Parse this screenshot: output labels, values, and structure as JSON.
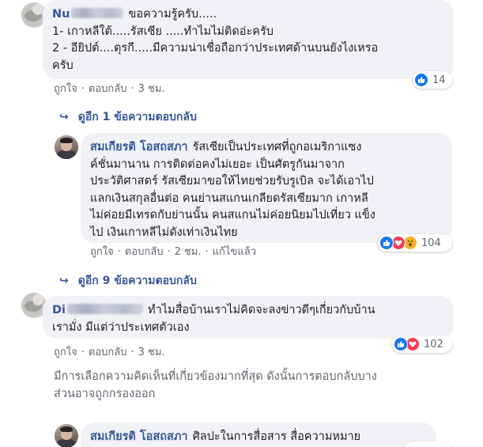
{
  "comments": [
    {
      "author": "Nu",
      "lines": [
        "ขอความรู้ครับ.....",
        "1- เกาหลีใต้.....รัสเซีย .....ทำไมไม่ติดอ่ะครับ",
        "2 - อียิปต์....ตุรกี.....มีความน่าเชื่อถือกว่าประเทศด้านบนยังไงเหรอ",
        "ครับ"
      ],
      "actions": {
        "like": "ถูกใจ",
        "reply": "ตอบกลับ",
        "time": "3 ชม."
      },
      "reaction_count": "14",
      "reactions": [
        "like"
      ]
    },
    {
      "view_replies": "ดูอีก 1 ข้อความตอบกลับ"
    },
    {
      "author": "สมเกียรติ โอสถสภา",
      "lines": [
        "รัสเซียเป็นประเทศที่ถูกอเมริกาแซง",
        "ค์ชั่นมานาน การติดต่อคงไม่เยอะ เป็นศัตรูกันมาจาก",
        "ประวัติศาสตร์ รัสเซียมาขอให้ไทยช่วยรับรูเบิล จะได้เอาไป",
        "แลกเงินสกุลอื่นต่อ คนย่านสแกนเกลียดรัสเซียมาก เกาหลี",
        "ไม่ค่อยมีเทรดกับย่านนั้น คนสแกนไม่ค่อยนิยมไปเที่ยว แข็ง",
        "ไป เงินเกาหลีไม่ดังเท่าเงินไทย"
      ],
      "actions": {
        "like": "ถูกใจ",
        "reply": "ตอบกลับ",
        "time": "2 ชม.",
        "edited": "แก้ไขแล้ว"
      },
      "reaction_count": "104",
      "reactions": [
        "like",
        "love",
        "wow"
      ]
    },
    {
      "view_replies": "ดูอีก 9 ข้อความตอบกลับ"
    },
    {
      "author": "Di",
      "lines": [
        "ทำไมสื่อบ้านเราไม่คิดจะลงข่าวดีๆเกี่ยวกับบ้าน",
        "เรามั่ง มีแต่ว่าประเทศตัวเอง"
      ],
      "actions": {
        "like": "ถูกใจ",
        "reply": "ตอบกลับ",
        "time": "3 ชม."
      },
      "reaction_count": "102",
      "reactions": [
        "like",
        "love"
      ]
    },
    {
      "notice_lines": [
        "มีการเลือกความคิดเห็นที่เกี่ยวข้องมากที่สุด ดังนั้นการตอบกลับบาง",
        "ส่วนอาจถูกกรองออก"
      ]
    },
    {
      "author": "สมเกียรติ โอสถสภา",
      "lines": [
        "ศิลปะในการสื่อสาร สื่อความหมาย"
      ]
    }
  ],
  "colors": {
    "link": "#385898",
    "bubble": "#f0f2f5",
    "like": "#1877f2",
    "love": "#f33e58",
    "wow": "#f7b125",
    "meta": "#606770"
  }
}
